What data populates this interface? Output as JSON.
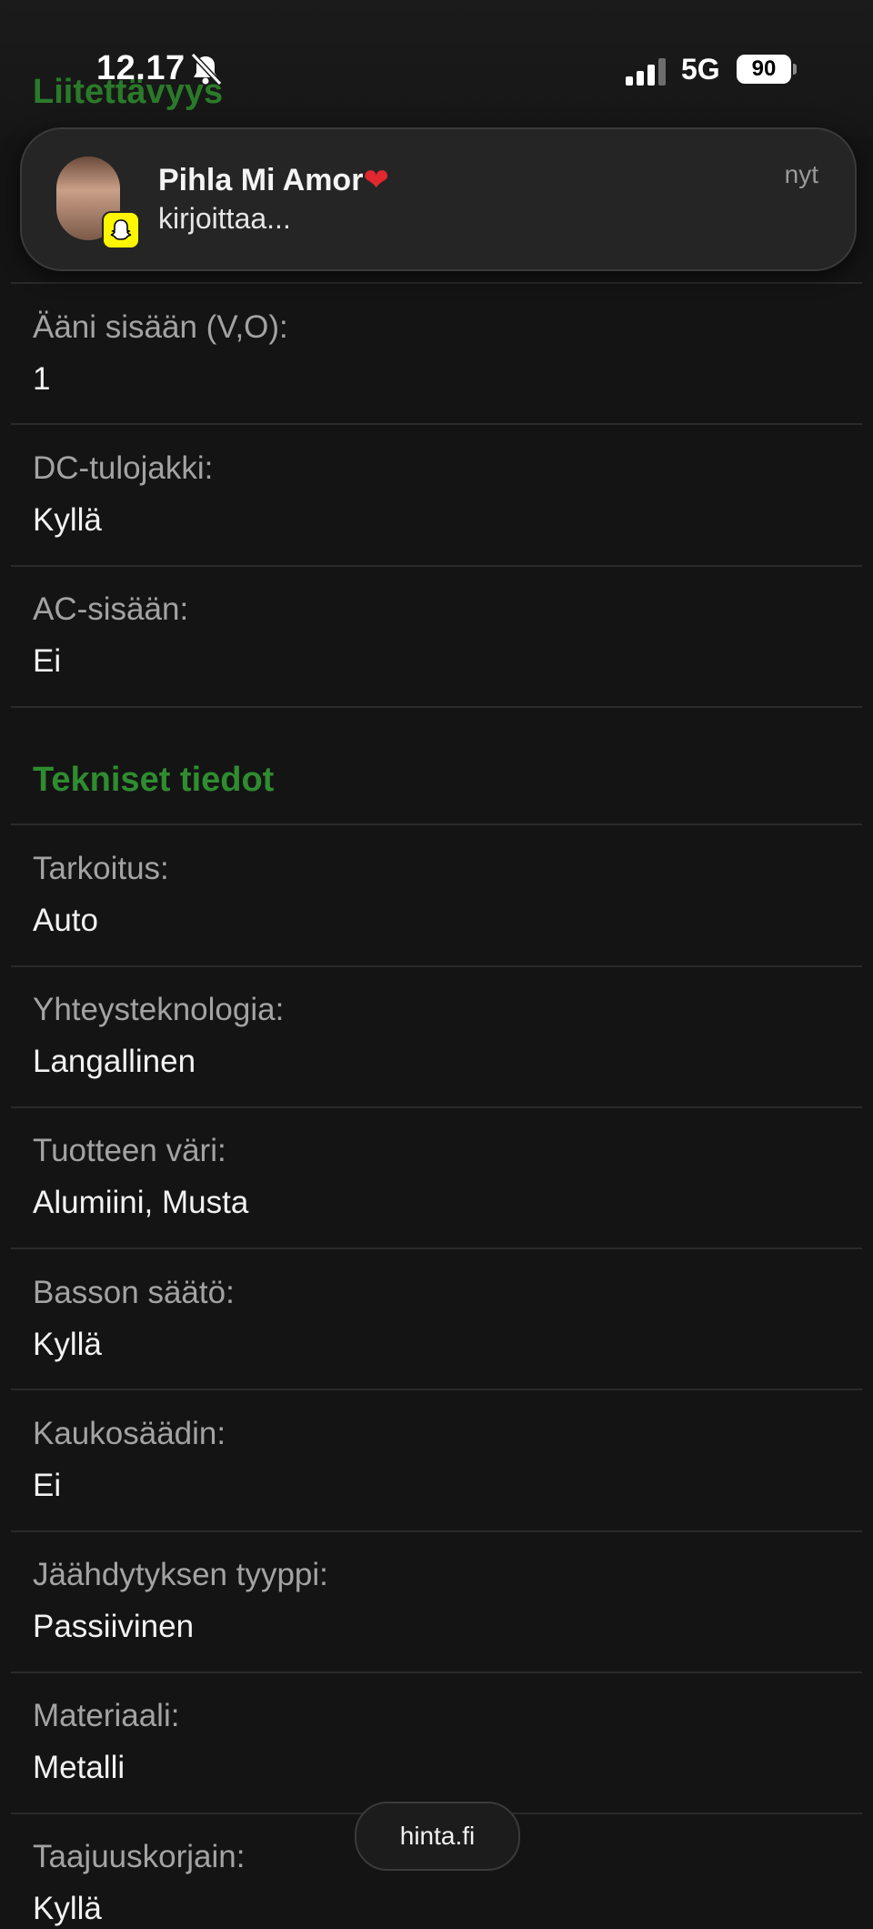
{
  "status_bar": {
    "time": "12.17",
    "network": "5G",
    "battery": "90"
  },
  "notification": {
    "name": "Pihla Mi Amor",
    "text": "kirjoittaa...",
    "time": "nyt",
    "app_icon": "snapchat-icon"
  },
  "top_section_title": "Liitettävyys",
  "connectivity_rows": [
    {
      "label": "Ääni sisään (V,O):",
      "value": "1"
    },
    {
      "label": "DC-tulojakki:",
      "value": "Kyllä"
    },
    {
      "label": "AC-sisään:",
      "value": "Ei"
    }
  ],
  "tech_section_title": "Tekniset tiedot",
  "tech_rows": [
    {
      "label": "Tarkoitus:",
      "value": "Auto"
    },
    {
      "label": "Yhteysteknologia:",
      "value": "Langallinen"
    },
    {
      "label": "Tuotteen väri:",
      "value": "Alumiini, Musta"
    },
    {
      "label": "Basson säätö:",
      "value": "Kyllä"
    },
    {
      "label": "Kaukosäädin:",
      "value": "Ei"
    },
    {
      "label": "Jäähdytyksen tyyppi:",
      "value": "Passiivinen"
    },
    {
      "label": "Materiaali:",
      "value": "Metalli"
    },
    {
      "label": "Taajuuskorjain:",
      "value": "Kyllä"
    }
  ],
  "site_pill": "hinta.fi",
  "colors": {
    "accent_green": "#2f8c2f",
    "background": "#141414"
  }
}
